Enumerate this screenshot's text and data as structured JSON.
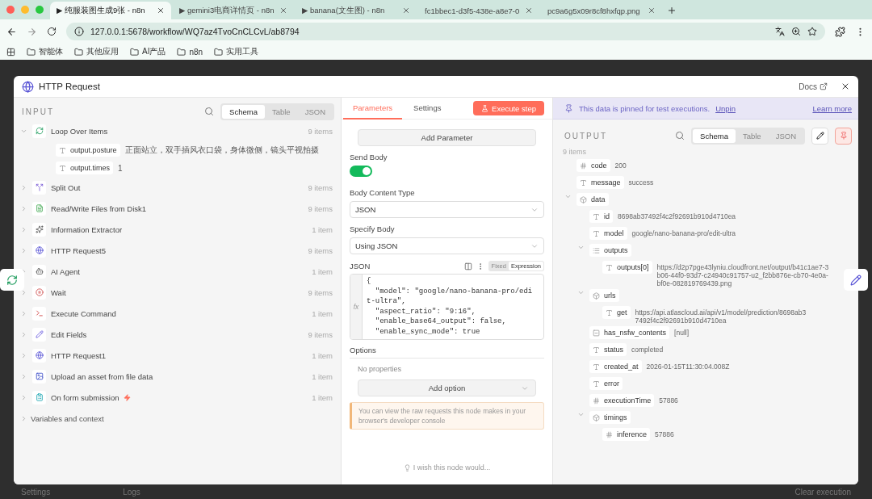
{
  "browser": {
    "tabs": [
      {
        "title": "▶ 纯服装图生成9张 - n8n",
        "selected": true
      },
      {
        "title": "▶ gemini3电商详情页 - n8n",
        "selected": false
      },
      {
        "title": "▶ banana(文生图) - n8n",
        "selected": false
      },
      {
        "title": "fc1bbec1-d3f5-438e-a8e7-0",
        "selected": false
      },
      {
        "title": "pc9a6g5x09r8cf8hxfqp.png",
        "selected": false
      }
    ],
    "address": "127.0.0.1:5678/workflow/WQ7az4TvoCnCLCvL/ab8794",
    "bookmarks": [
      "智能体",
      "其他应用",
      "AI产品",
      "n8n",
      "实用工具"
    ]
  },
  "background": {
    "settings": "Settings",
    "logs": "Logs",
    "clear": "Clear execution"
  },
  "modal": {
    "title": "HTTP Request",
    "docs": "Docs"
  },
  "input": {
    "heading": "INPUT",
    "view_tabs": [
      {
        "label": "Schema",
        "selected": true
      },
      {
        "label": "Table",
        "selected": false
      },
      {
        "label": "JSON",
        "selected": false
      }
    ],
    "nodes": [
      {
        "name": "Loop Over Items",
        "count": "9 items",
        "expanded": true,
        "fields": [
          {
            "key": "output.posture",
            "value": "正面站立，双手插风衣口袋，身体微侧，镜头平视拍摄"
          },
          {
            "key": "output.times",
            "value": "1"
          }
        ]
      },
      {
        "name": "Split Out",
        "count": "9 items",
        "expanded": false
      },
      {
        "name": "Read/Write Files from Disk1",
        "count": "9 items",
        "expanded": false
      },
      {
        "name": "Information Extractor",
        "count": "1 item",
        "expanded": false
      },
      {
        "name": "HTTP Request5",
        "count": "9 items",
        "expanded": false
      },
      {
        "name": "AI Agent",
        "count": "1 item",
        "expanded": false
      },
      {
        "name": "Wait",
        "count": "9 items",
        "expanded": false
      },
      {
        "name": "Execute Command",
        "count": "1 item",
        "expanded": false
      },
      {
        "name": "Edit Fields",
        "count": "9 items",
        "expanded": false
      },
      {
        "name": "HTTP Request1",
        "count": "1 item",
        "expanded": false
      },
      {
        "name": "Upload an asset from file data",
        "count": "1 item",
        "expanded": false
      },
      {
        "name": "On form submission",
        "count": "1 item",
        "expanded": false,
        "trigger": true
      }
    ],
    "variables": "Variables and context"
  },
  "parameters": {
    "tabs": [
      {
        "label": "Parameters",
        "selected": true
      },
      {
        "label": "Settings",
        "selected": false
      }
    ],
    "execute": "Execute step",
    "add_parameter": "Add Parameter",
    "send_body": {
      "label": "Send Body",
      "on": true
    },
    "body_content_type": {
      "label": "Body Content Type",
      "value": "JSON"
    },
    "specify_body": {
      "label": "Specify Body",
      "value": "Using JSON"
    },
    "json_editor": {
      "label": "JSON",
      "modes": [
        {
          "label": "Fixed",
          "selected": false
        },
        {
          "label": "Expression",
          "selected": true
        }
      ],
      "fx": "fx",
      "lines": [
        "{",
        "  \"model\": \"google/nano-banana-pro/edit-ultra\",",
        "  \"aspect_ratio\": \"9:16\",",
        "  \"enable_base64_output\": false,",
        "  \"enable_sync_mode\": true"
      ]
    },
    "options": {
      "label": "Options",
      "empty": "No properties",
      "add": "Add option"
    },
    "notice": "You can view the raw requests this node makes in your browser's developer console",
    "wish": "I wish this node would..."
  },
  "output": {
    "banner": {
      "text": "This data is pinned for test executions.",
      "unpin": "Unpin",
      "learn": "Learn more"
    },
    "heading": "OUTPUT",
    "view_tabs": [
      {
        "label": "Schema",
        "selected": true
      },
      {
        "label": "Table",
        "selected": false
      },
      {
        "label": "JSON",
        "selected": false
      }
    ],
    "count": "9 items",
    "fields": [
      {
        "kind": "number",
        "key": "code",
        "value": "200"
      },
      {
        "kind": "string",
        "key": "message",
        "value": "success"
      },
      {
        "kind": "object",
        "key": "data",
        "expanded": true,
        "children": [
          {
            "kind": "string",
            "key": "id",
            "value": "8698ab37492f4c2f92691b910d4710ea"
          },
          {
            "kind": "string",
            "key": "model",
            "value": "google/nano-banana-pro/edit-ultra"
          },
          {
            "kind": "array",
            "key": "outputs",
            "expanded": true,
            "children": [
              {
                "kind": "string",
                "key": "outputs[0]",
                "value": "https://d2p7pge43lyniu.cloudfront.net/output/b41c1ae7-3b06-44f0-93d7-c24940c91757-u2_f2bb876e-cb70-4e0a-bf0e-082819769439.png"
              }
            ]
          },
          {
            "kind": "object",
            "key": "urls",
            "expanded": true,
            "children": [
              {
                "kind": "string",
                "key": "get",
                "value": "https://api.atlascloud.ai/api/v1/model/prediction/8698ab37492f4c2f92691b910d4710ea"
              }
            ]
          },
          {
            "kind": "null",
            "key": "has_nsfw_contents",
            "value": "[null]"
          },
          {
            "kind": "string",
            "key": "status",
            "value": "completed"
          },
          {
            "kind": "string",
            "key": "created_at",
            "value": "2026-01-15T11:30:04.008Z"
          },
          {
            "kind": "string",
            "key": "error"
          },
          {
            "kind": "number",
            "key": "executionTime",
            "value": "57886"
          },
          {
            "kind": "object",
            "key": "timings",
            "expanded": true,
            "children": [
              {
                "kind": "number",
                "key": "inference",
                "value": "57886"
              }
            ]
          }
        ]
      }
    ]
  }
}
